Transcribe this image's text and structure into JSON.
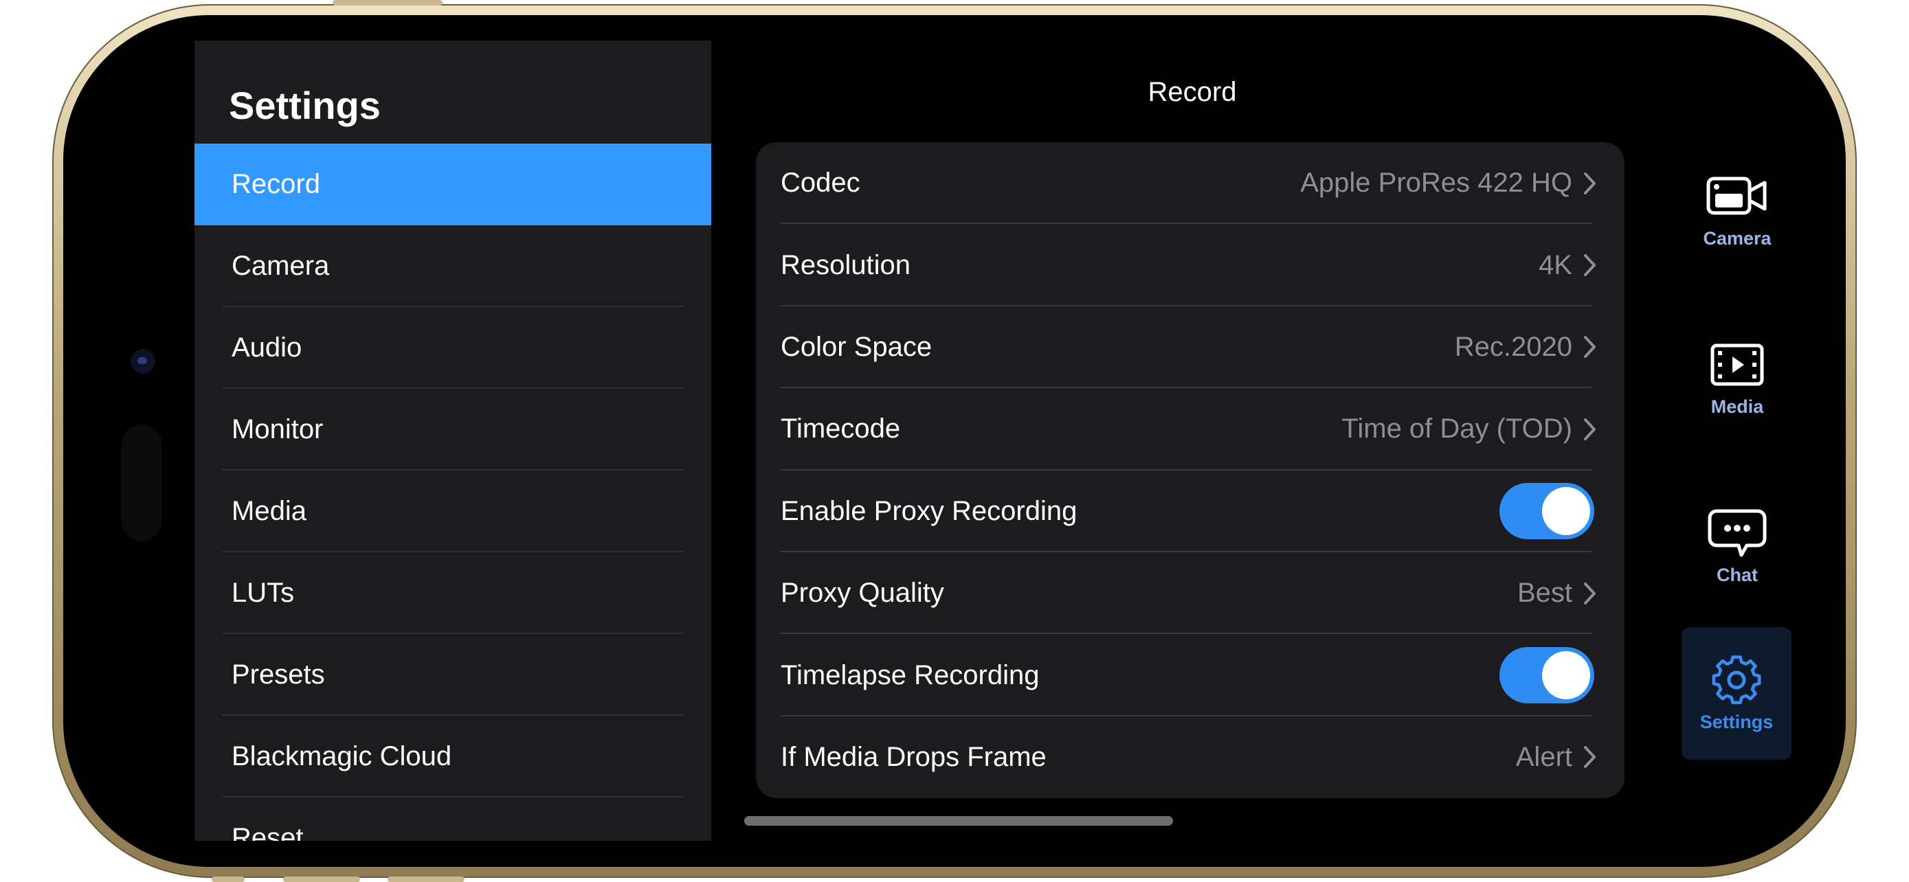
{
  "sidebar": {
    "title": "Settings",
    "items": [
      {
        "label": "Record",
        "active": true
      },
      {
        "label": "Camera"
      },
      {
        "label": "Audio"
      },
      {
        "label": "Monitor"
      },
      {
        "label": "Media"
      },
      {
        "label": "LUTs"
      },
      {
        "label": "Presets"
      },
      {
        "label": "Blackmagic Cloud"
      },
      {
        "label": "Reset"
      }
    ]
  },
  "main": {
    "title": "Record",
    "rows": [
      {
        "label": "Codec",
        "value": "Apple ProRes 422 HQ"
      },
      {
        "label": "Resolution",
        "value": "4K"
      },
      {
        "label": "Color Space",
        "value": "Rec.2020"
      },
      {
        "label": "Timecode",
        "value": "Time of Day (TOD)"
      },
      {
        "label": "Enable Proxy Recording",
        "toggle": true
      },
      {
        "label": "Proxy Quality",
        "value": "Best"
      },
      {
        "label": "Timelapse Recording",
        "toggle": true
      },
      {
        "label": "If Media Drops Frame",
        "value": "Alert"
      }
    ]
  },
  "tabs": [
    {
      "label": "Camera",
      "icon": "camera-icon"
    },
    {
      "label": "Media",
      "icon": "film-play-icon"
    },
    {
      "label": "Chat",
      "icon": "chat-bubble-icon"
    },
    {
      "label": "Settings",
      "icon": "gear-icon",
      "active": true
    }
  ],
  "colors": {
    "accent": "#3399ff",
    "toggle_on": "#2f8cf2",
    "panel": "#1c1c1e",
    "tab_label": "#9db4e6",
    "tab_active_label": "#3d8bef"
  }
}
